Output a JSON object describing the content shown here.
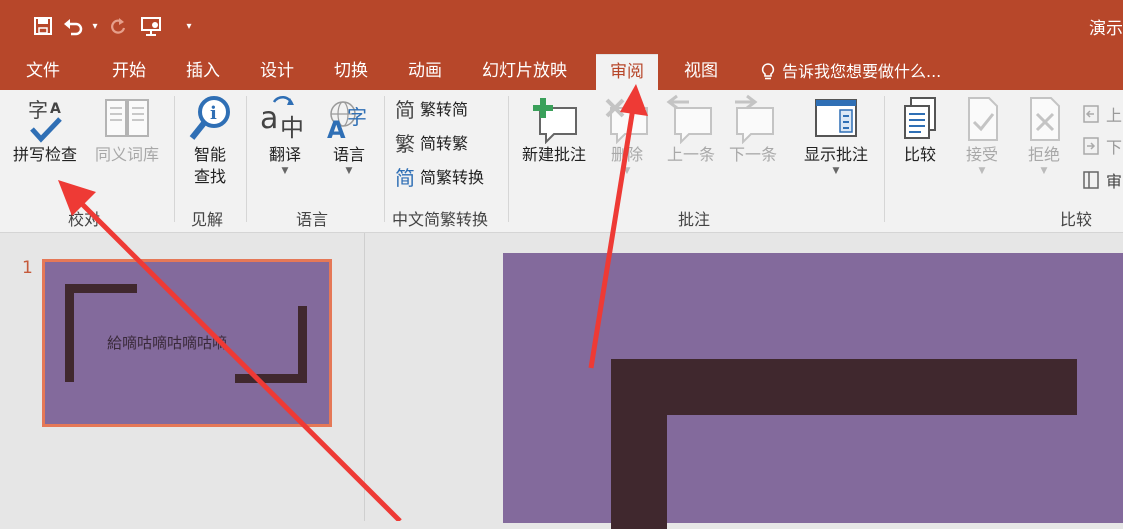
{
  "window": {
    "title": "演示"
  },
  "qat": {
    "save": "save-icon",
    "undo": "undo-icon",
    "redo": "redo-icon",
    "present": "present-from-start-icon",
    "customize": "customize-qat-icon"
  },
  "tabs": [
    {
      "label": "文件"
    },
    {
      "label": "开始"
    },
    {
      "label": "插入"
    },
    {
      "label": "设计"
    },
    {
      "label": "切换"
    },
    {
      "label": "动画"
    },
    {
      "label": "幻灯片放映"
    },
    {
      "label": "审阅",
      "active": true
    },
    {
      "label": "视图"
    }
  ],
  "tell_me": "告诉我您想要做什么...",
  "ribbon": {
    "proofing": {
      "label": "校对",
      "spell": "拼写检查",
      "thesaurus": "同义词库"
    },
    "insights": {
      "label": "见解",
      "smart_lookup_1": "智能",
      "smart_lookup_2": "查找"
    },
    "language": {
      "label": "语言",
      "translate": "翻译",
      "language": "语言"
    },
    "chinese": {
      "label": "中文简繁转换",
      "to_traditional": "繁转简",
      "to_simplified": "简转繁",
      "convert": "简繁转换",
      "glyph_1": "简",
      "glyph_2": "繁",
      "glyph_3": "简"
    },
    "comments": {
      "label": "批注",
      "new": "新建批注",
      "delete": "删除",
      "prev": "上一条",
      "next": "下一条",
      "show": "显示批注"
    },
    "compare": {
      "label": "比较",
      "compare": "比较",
      "accept": "接受",
      "reject": "拒绝",
      "prev": "上",
      "next": "下",
      "pane": "审"
    }
  },
  "slides": {
    "number": "1",
    "thumb_text": "給嘀咕嘀咕嘀咕嘀"
  },
  "colors": {
    "accent": "#b7472a",
    "slide_bg": "#836a9c",
    "slide_shape": "#40282e",
    "arrow": "#ee3a35"
  }
}
